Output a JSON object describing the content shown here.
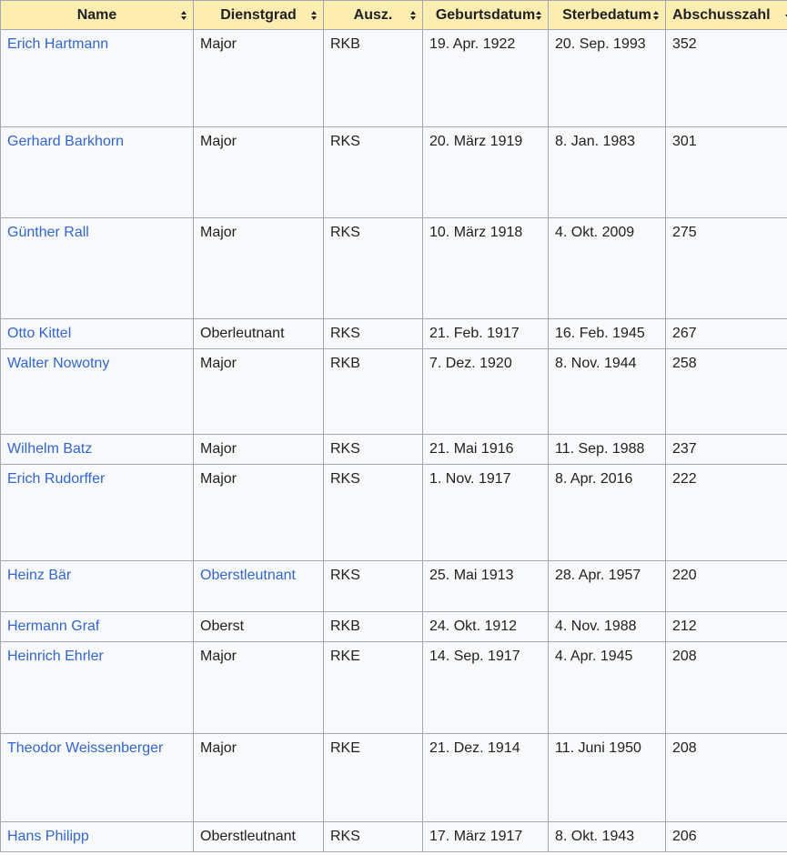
{
  "columns": [
    {
      "label": "Name",
      "sort": "both"
    },
    {
      "label": "Dienstgrad",
      "sort": "both"
    },
    {
      "label": "Ausz.",
      "sort": "both"
    },
    {
      "label": "Geburtsdatum",
      "sort": "both"
    },
    {
      "label": "Sterbedatum",
      "sort": "both"
    },
    {
      "label": "Abschusszahl",
      "sort": "down"
    }
  ],
  "rows": [
    {
      "name": "Erich Hartmann",
      "rank": "Major",
      "award": "RKB",
      "born": "19. Apr. 1922",
      "died": "20. Sep. 1993",
      "kills": "352"
    },
    {
      "name": "Gerhard Barkhorn",
      "rank": "Major",
      "award": "RKS",
      "born": "20. März 1919",
      "died": "8. Jan. 1983",
      "kills": "301"
    },
    {
      "name": "Günther Rall",
      "rank": "Major",
      "award": "RKS",
      "born": "10. März 1918",
      "died": "4. Okt. 2009",
      "kills": "275"
    },
    {
      "name": "Otto Kittel",
      "rank": "Oberleutnant",
      "award": "RKS",
      "born": "21. Feb. 1917",
      "died": "16. Feb. 1945",
      "kills": "267"
    },
    {
      "name": "Walter Nowotny",
      "rank": "Major",
      "award": "RKB",
      "born": "7. Dez. 1920",
      "died": "8. Nov. 1944",
      "kills": "258"
    },
    {
      "name": "Wilhelm Batz",
      "rank": "Major",
      "award": "RKS",
      "born": "21. Mai 1916",
      "died": "11. Sep. 1988",
      "kills": "237"
    },
    {
      "name": "Erich Rudorffer",
      "rank": "Major",
      "award": "RKS",
      "born": "1. Nov. 1917",
      "died": "8. Apr. 2016",
      "kills": "222"
    },
    {
      "name": "Heinz Bär",
      "rank": "Oberstleutnant",
      "award": "RKS",
      "born": "25. Mai 1913",
      "died": "28. Apr. 1957",
      "kills": "220"
    },
    {
      "name": "Hermann Graf",
      "rank": "Oberst",
      "award": "RKB",
      "born": "24. Okt. 1912",
      "died": "4. Nov. 1988",
      "kills": "212"
    },
    {
      "name": "Heinrich Ehrler",
      "rank": "Major",
      "award": "RKE",
      "born": "14. Sep. 1917",
      "died": "4. Apr. 1945",
      "kills": "208"
    },
    {
      "name": "Theodor Weissenberger",
      "rank": "Major",
      "award": "RKE",
      "born": "21. Dez. 1914",
      "died": "11. Juni 1950",
      "kills": "208"
    },
    {
      "name": "Hans Philipp",
      "rank": "Oberstleutnant",
      "award": "RKS",
      "born": "17. März 1917",
      "died": "8. Okt. 1943",
      "kills": "206"
    }
  ],
  "rank_links": [
    "Oberstleutnant@7"
  ],
  "colors": {
    "header_bg": "#fdedb1",
    "cell_bg": "#f8f9fa",
    "border": "#a2a9b1",
    "link": "#3366cc",
    "text": "#202122"
  }
}
